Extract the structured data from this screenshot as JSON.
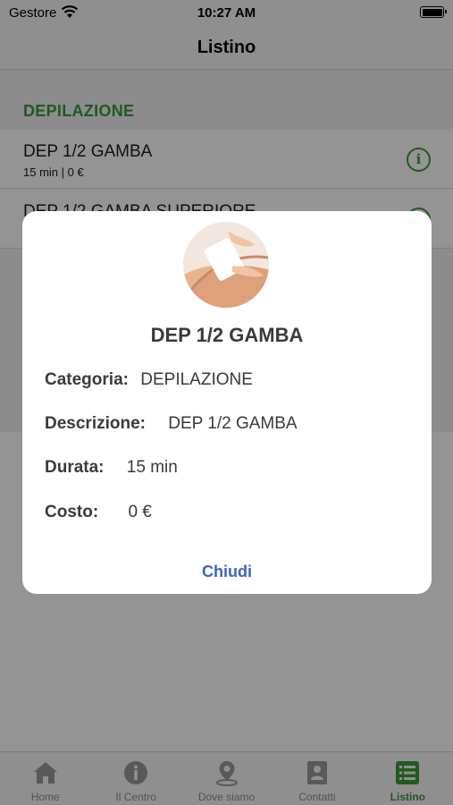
{
  "status_bar": {
    "carrier": "Gestore",
    "time": "10:27 AM"
  },
  "nav": {
    "title": "Listino"
  },
  "section": {
    "header": "DEPILAZIONE"
  },
  "list": {
    "items": [
      {
        "name": "DEP 1/2 GAMBA",
        "meta": "15 min | 0 €"
      },
      {
        "name": "DEP 1/2 GAMBA SUPERIORE",
        "meta": ""
      }
    ]
  },
  "modal": {
    "title": "DEP 1/2 GAMBA",
    "fields": [
      {
        "key": "Categoria:",
        "value": "DEPILAZIONE"
      },
      {
        "key": "Descrizione:",
        "value": "DEP 1/2 GAMBA"
      },
      {
        "key": "Durata:",
        "value": "15 min"
      },
      {
        "key": "Costo:",
        "value": "0 €"
      }
    ],
    "close_label": "Chiudi"
  },
  "tabs": [
    {
      "label": "Home",
      "icon": "home-icon"
    },
    {
      "label": "Il Centro",
      "icon": "info-icon"
    },
    {
      "label": "Dove siamo",
      "icon": "location-pin-icon"
    },
    {
      "label": "Contatti",
      "icon": "contacts-icon"
    },
    {
      "label": "Listino",
      "icon": "list-icon",
      "active": true
    }
  ],
  "colors": {
    "accent_green": "#3a9a3a",
    "link_blue": "#3b63c4",
    "overlay": "rgba(0,0,0,0.42)"
  }
}
